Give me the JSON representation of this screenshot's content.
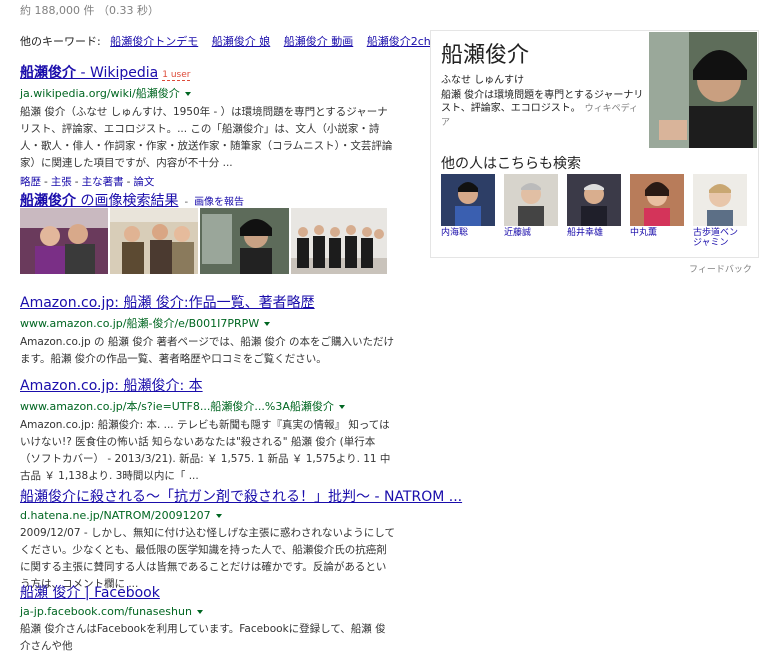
{
  "stats": "約 188,000 件 （0.33 秒）",
  "related": {
    "label": "他のキーワード:",
    "items": [
      "船瀬俊介トンデモ",
      "船瀬俊介 娘",
      "船瀬俊介 動画",
      "船瀬俊介2ch"
    ]
  },
  "results": [
    {
      "title_bold": "船瀬俊介",
      "title_rest": " - Wikipedia",
      "badge": "1 user",
      "url": "ja.wikipedia.org/wiki/船瀬俊介",
      "snippet": "船瀬 俊介（ふなせ しゅんすけ、1950年 - ）は環境問題を専門とするジャーナリスト、評論家、エコロジスト。... この「船瀬俊介」は、文人（小説家・詩人・歌人・俳人・作詞家・作家・放送作家・随筆家（コラムニスト）・文芸評論家）に関連した項目ですが、内容が不十分 ...",
      "sublinks": [
        "略歴",
        "主張",
        "主な著書",
        "論文"
      ]
    },
    {
      "title": "Amazon.co.jp: 船瀬 俊介:作品一覧、著者略歴",
      "url": "www.amazon.co.jp/船瀬-俊介/e/B001I7PRPW",
      "snippet": "Amazon.co.jp の 船瀬 俊介 著者ページでは、船瀬 俊介 の本をご購入いただけます。船瀬 俊介の作品一覧、著者略歴や口コミをご覧ください。"
    },
    {
      "title": "Amazon.co.jp: 船瀬俊介: 本",
      "url": "www.amazon.co.jp/本/s?ie=UTF8...船瀬俊介...%3A船瀬俊介",
      "snippet": "Amazon.co.jp: 船瀬俊介: 本. ... テレビも新聞も隠す『真実の情報』 知ってはいけない!? 医食住の怖い話 知らないあなたは\"殺される\" 船瀬 俊介 (単行本（ソフトカバー） - 2013/3/21). 新品: ￥ 1,575. 1 新品 ￥ 1,575より. 11 中古品 ￥ 1,138より. 3時間以内に「 ..."
    },
    {
      "title": "船瀬俊介に殺される〜「抗ガン剤で殺される！」批判〜 - NATROM ...",
      "url": "d.hatena.ne.jp/NATROM/20091207",
      "snippet": "2009/12/07 - しかし、無知に付け込む怪しげな主張に惑わされないようにしてください。少なくとも、最低限の医学知識を持った人で、船瀬俊介氏の抗癌剤に関する主張に賛同する人は皆無であることだけは確かです。反論があるという方は、コメント欄に ..."
    },
    {
      "title": "船瀬 俊介 | Facebook",
      "url": "ja-jp.facebook.com/funaseshun",
      "snippet": "船瀬 俊介さんはFacebookを利用しています。Facebookに登録して、船瀬 俊介さんや他"
    }
  ],
  "images": {
    "title_bold": "船瀬俊介",
    "title_rest": " の画像検索結果",
    "report": "画像を報告"
  },
  "knowledge_panel": {
    "name": "船瀬俊介",
    "reading": "ふなせ しゅんすけ",
    "description": "船瀬 俊介は環境問題を専門とするジャーナリスト、評論家、エコロジスト。",
    "source": "ウィキペディア",
    "others_title": "他の人はこちらも検索",
    "people": [
      "内海聡",
      "近藤誠",
      "船井幸雄",
      "中丸薫",
      "古歩道ベンジャミン"
    ]
  },
  "feedback": "フィードバック",
  "colors": {
    "link": "#1a0dab",
    "url": "#006621"
  }
}
